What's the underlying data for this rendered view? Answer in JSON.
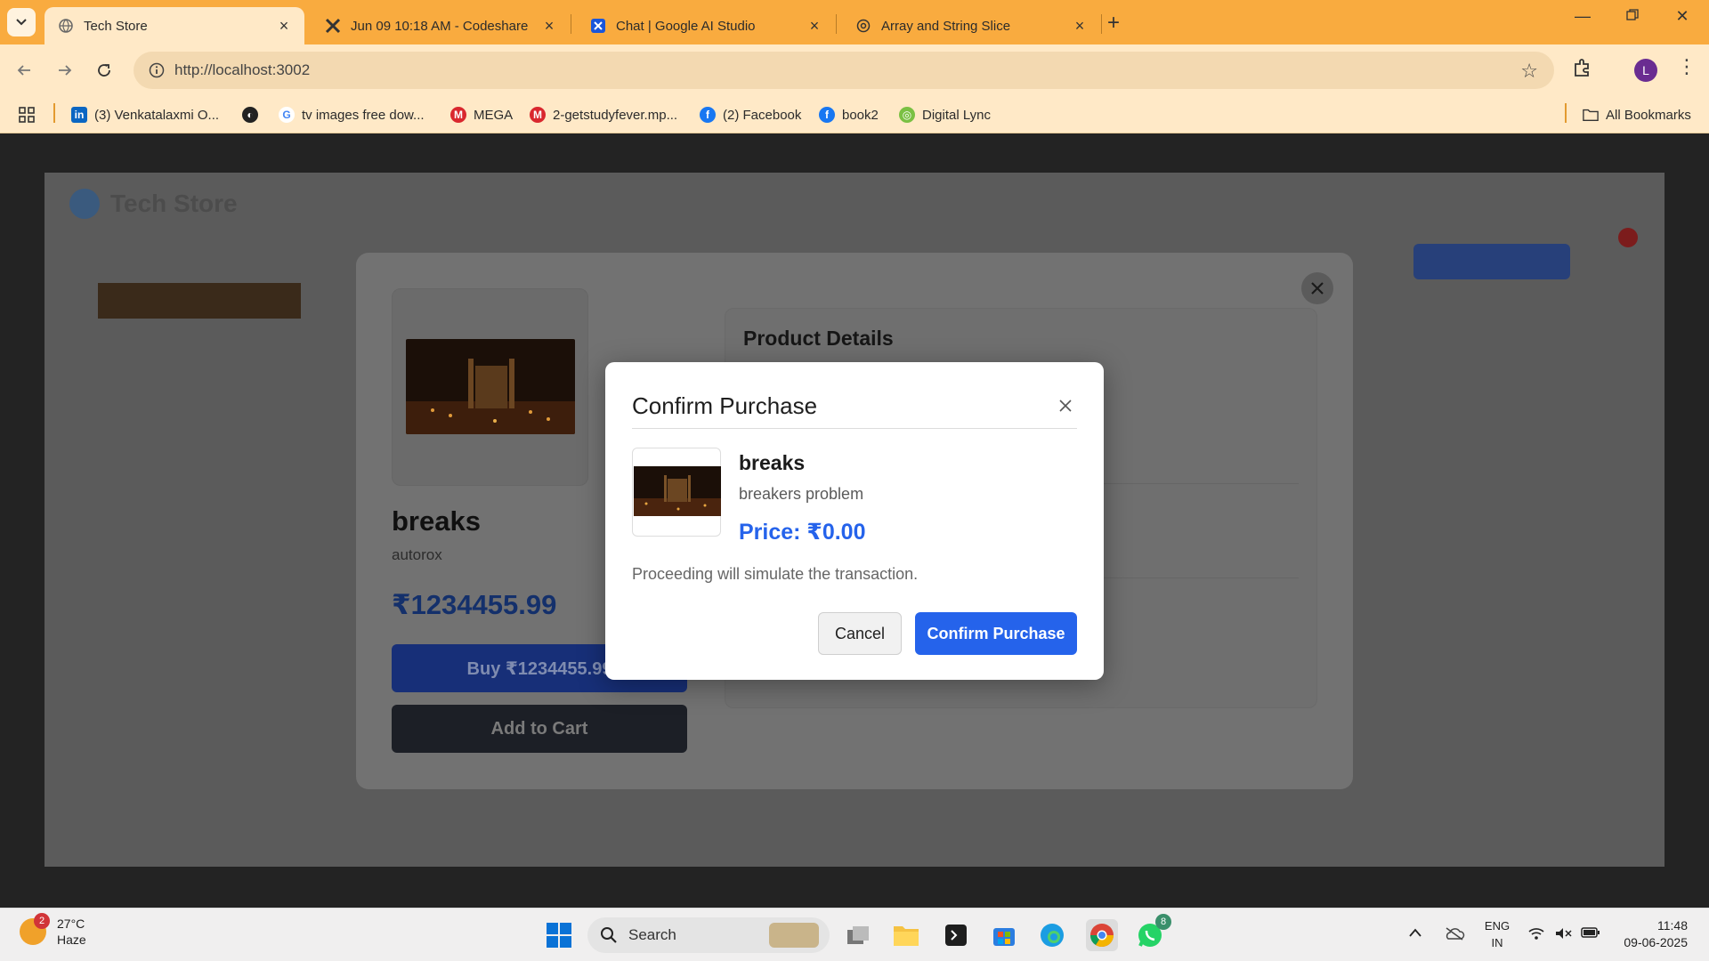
{
  "browser": {
    "tabs": [
      {
        "title": "Tech Store",
        "active": true
      },
      {
        "title": "Jun 09 10:18 AM - Codeshare",
        "active": false
      },
      {
        "title": "Chat | Google AI Studio",
        "active": false
      },
      {
        "title": "Array and String Slice",
        "active": false
      }
    ],
    "url": "http://localhost:3002",
    "profile_initial": "L",
    "bookmarks": [
      {
        "label": "(3) Venkatalaxmi O...",
        "icon": "linkedin-icon"
      },
      {
        "label": "",
        "icon": "globe-icon"
      },
      {
        "label": "tv images free dow...",
        "icon": "google-icon"
      },
      {
        "label": "MEGA",
        "icon": "mega-icon"
      },
      {
        "label": "2-getstudyfever.mp...",
        "icon": "mega-icon"
      },
      {
        "label": "(2) Facebook",
        "icon": "facebook-icon"
      },
      {
        "label": "book2",
        "icon": "facebook-icon"
      },
      {
        "label": "Digital Lync",
        "icon": "digital-lync-icon"
      }
    ],
    "all_bookmarks": "All Bookmarks"
  },
  "background_page": {
    "brand": "Tech Store"
  },
  "product_modal": {
    "name": "breaks",
    "brand": "autorox",
    "price": "₹1234455.99",
    "buy_label": "Buy ₹1234455.99",
    "add_to_cart_label": "Add to Cart",
    "details_title": "Product Details"
  },
  "confirm_dialog": {
    "title": "Confirm Purchase",
    "product_name": "breaks",
    "product_description": "breakers problem",
    "price_text": "Price: ₹0.00",
    "note": "Proceeding will simulate the transaction.",
    "cancel_label": "Cancel",
    "confirm_label": "Confirm Purchase"
  },
  "taskbar": {
    "weather_temp": "27°C",
    "weather_desc": "Haze",
    "weather_badge": "2",
    "search_label": "Search",
    "whatsapp_badge": "8",
    "lang_line1": "ENG",
    "lang_line2": "IN",
    "time": "11:48",
    "date": "09-06-2025"
  },
  "colors": {
    "accent_blue": "#2563eb",
    "chrome_orange": "#f9ab3f",
    "chrome_light": "#ffe9c7"
  }
}
